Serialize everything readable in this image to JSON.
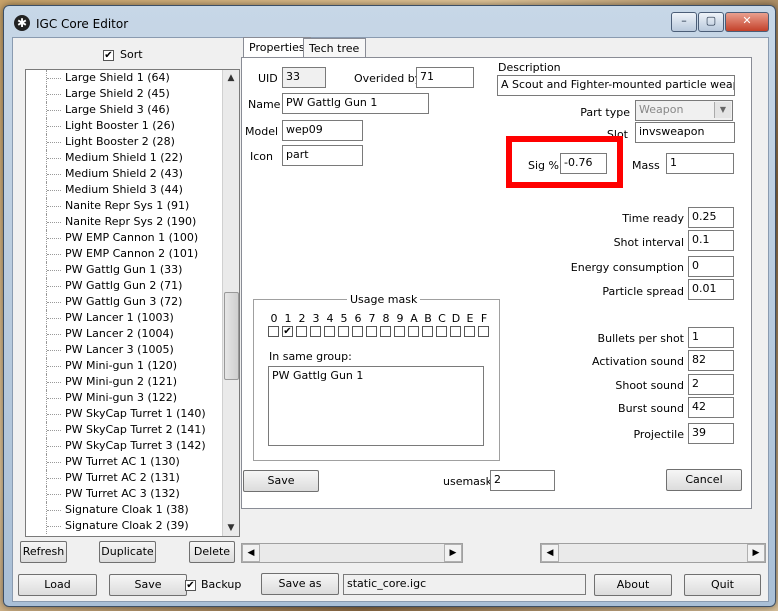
{
  "window": {
    "title": "IGC Core Editor",
    "icon": "app-star-icon",
    "min": "–",
    "max": "▢",
    "close": "✕"
  },
  "sort": {
    "label": "Sort",
    "checked": true
  },
  "list_items": [
    "Large Shield 1 (64)",
    "Large Shield 2 (45)",
    "Large Shield 3 (46)",
    "Light Booster 1 (26)",
    "Light Booster 2 (28)",
    "Medium Shield 1 (22)",
    "Medium Shield 2 (43)",
    "Medium Shield 3 (44)",
    "Nanite Repr Sys 1 (91)",
    "Nanite Repr Sys 2 (190)",
    "PW EMP Cannon 1 (100)",
    "PW EMP Cannon 2 (101)",
    "PW Gattlg Gun 1 (33)",
    "PW Gattlg Gun 2 (71)",
    "PW Gattlg Gun 3 (72)",
    "PW Lancer 1 (1003)",
    "PW Lancer 2 (1004)",
    "PW Lancer 3 (1005)",
    "PW Mini-gun 1 (120)",
    "PW Mini-gun 2 (121)",
    "PW Mini-gun 3 (122)",
    "PW SkyCap Turret 1 (140)",
    "PW SkyCap Turret 2 (141)",
    "PW SkyCap Turret 3 (142)",
    "PW Turret AC 1 (130)",
    "PW Turret AC 2 (131)",
    "PW Turret AC 3 (132)",
    "Signature Cloak 1 (38)",
    "Signature Cloak 2 (39)"
  ],
  "list_buttons": {
    "refresh": "Refresh",
    "duplicate": "Duplicate",
    "delete": "Delete"
  },
  "tabs": {
    "properties": "Properties",
    "techtree": "Tech tree"
  },
  "props": {
    "uid_label": "UID",
    "uid": "33",
    "overided_label": "Overided by",
    "overided": "71",
    "name_label": "Name",
    "name": "PW Gattlg Gun 1",
    "model_label": "Model",
    "model": "wep09",
    "icon_label": "Icon",
    "icon": "part",
    "description_label": "Description",
    "description": "A Scout and Fighter-mounted particle weapon goo",
    "parttype_label": "Part type",
    "parttype": "Weapon",
    "slot_label": "Slot",
    "slot": "invsweapon",
    "sig_label": "Sig %",
    "sig": "-0.76",
    "mass_label": "Mass",
    "mass": "1",
    "timeready_label": "Time ready",
    "timeready": "0.25",
    "shotinterval_label": "Shot interval",
    "shotinterval": "0.1",
    "energy_label": "Energy consumption",
    "energy": "0",
    "spread_label": "Particle spread",
    "spread": "0.01",
    "bullets_label": "Bullets per shot",
    "bullets": "1",
    "activation_label": "Activation sound",
    "activation": "82",
    "shoot_label": "Shoot sound",
    "shoot": "2",
    "burst_label": "Burst sound",
    "burst": "42",
    "projectile_label": "Projectile",
    "projectile": "39",
    "usagemask_label": "Usage mask",
    "mask_letters": [
      "0",
      "1",
      "2",
      "3",
      "4",
      "5",
      "6",
      "7",
      "8",
      "9",
      "A",
      "B",
      "C",
      "D",
      "E",
      "F"
    ],
    "mask_checked_index": 1,
    "samegroup_label": "In same group:",
    "samegroup_items": [
      "PW Gattlg Gun 1"
    ],
    "usemask_label": "usemask",
    "usemask": "2",
    "save": "Save",
    "cancel": "Cancel"
  },
  "bottom": {
    "load": "Load",
    "save": "Save",
    "backup_label": "Backup",
    "backup_checked": true,
    "saveas": "Save as",
    "filename": "static_core.igc",
    "about": "About",
    "quit": "Quit"
  },
  "highlight_color": "#ff0000"
}
